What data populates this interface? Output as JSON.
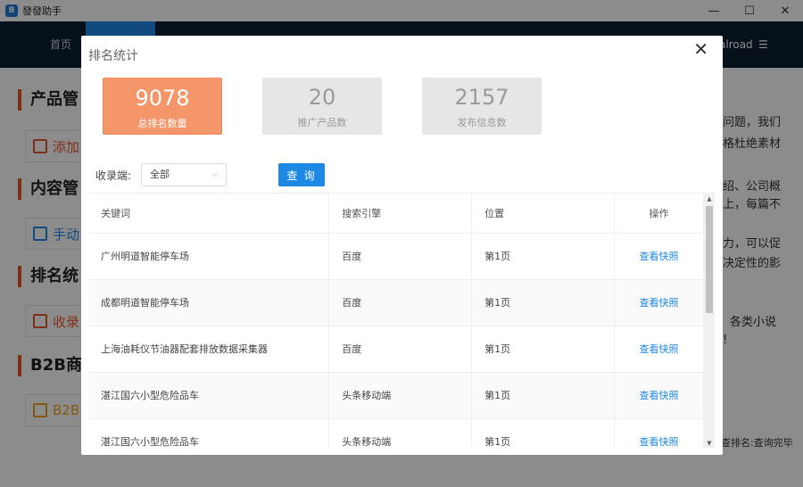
{
  "window": {
    "title": "發發助手",
    "logo_text": "B",
    "minimize": "—",
    "maximize": "☐",
    "close": "✕"
  },
  "nav": {
    "home": "首页",
    "user": "alroad",
    "menu_icon": "☰"
  },
  "background": {
    "sections": [
      "产品管",
      "内容管",
      "排名统",
      "B2B商"
    ],
    "buttons": [
      "添加",
      "手动",
      "收录",
      "B2B"
    ],
    "texts": [
      "问题，我们",
      "格杜绝素材",
      "绍、公司概",
      "上，每篇不",
      "力，可以促",
      "决定性的影",
      "各类小说",
      "!",
      "查排名:查询完毕"
    ]
  },
  "modal": {
    "title": "排名统计",
    "close_icon": "✕",
    "stats": [
      {
        "value": "9078",
        "label": "总排名数量"
      },
      {
        "value": "20",
        "label": "推广产品数"
      },
      {
        "value": "2157",
        "label": "发布信息数"
      }
    ],
    "filter": {
      "label": "收录端:",
      "selected": "全部"
    },
    "query_button": "查 询",
    "table": {
      "headers": [
        "关键词",
        "搜索引擎",
        "位置",
        "操作"
      ],
      "rows": [
        {
          "keyword": "广州明道智能停车场",
          "engine": "百度",
          "position": "第1页",
          "action": "查看快照"
        },
        {
          "keyword": "成都明道智能停车场",
          "engine": "百度",
          "position": "第1页",
          "action": "查看快照"
        },
        {
          "keyword": "上海油耗仪节油器配套排放数据采集器",
          "engine": "百度",
          "position": "第1页",
          "action": "查看快照"
        },
        {
          "keyword": "湛江国六小型危险品车",
          "engine": "头条移动端",
          "position": "第1页",
          "action": "查看快照"
        },
        {
          "keyword": "湛江国六小型危险品车",
          "engine": "头条移动端",
          "position": "第1页",
          "action": "查看快照"
        }
      ]
    }
  }
}
